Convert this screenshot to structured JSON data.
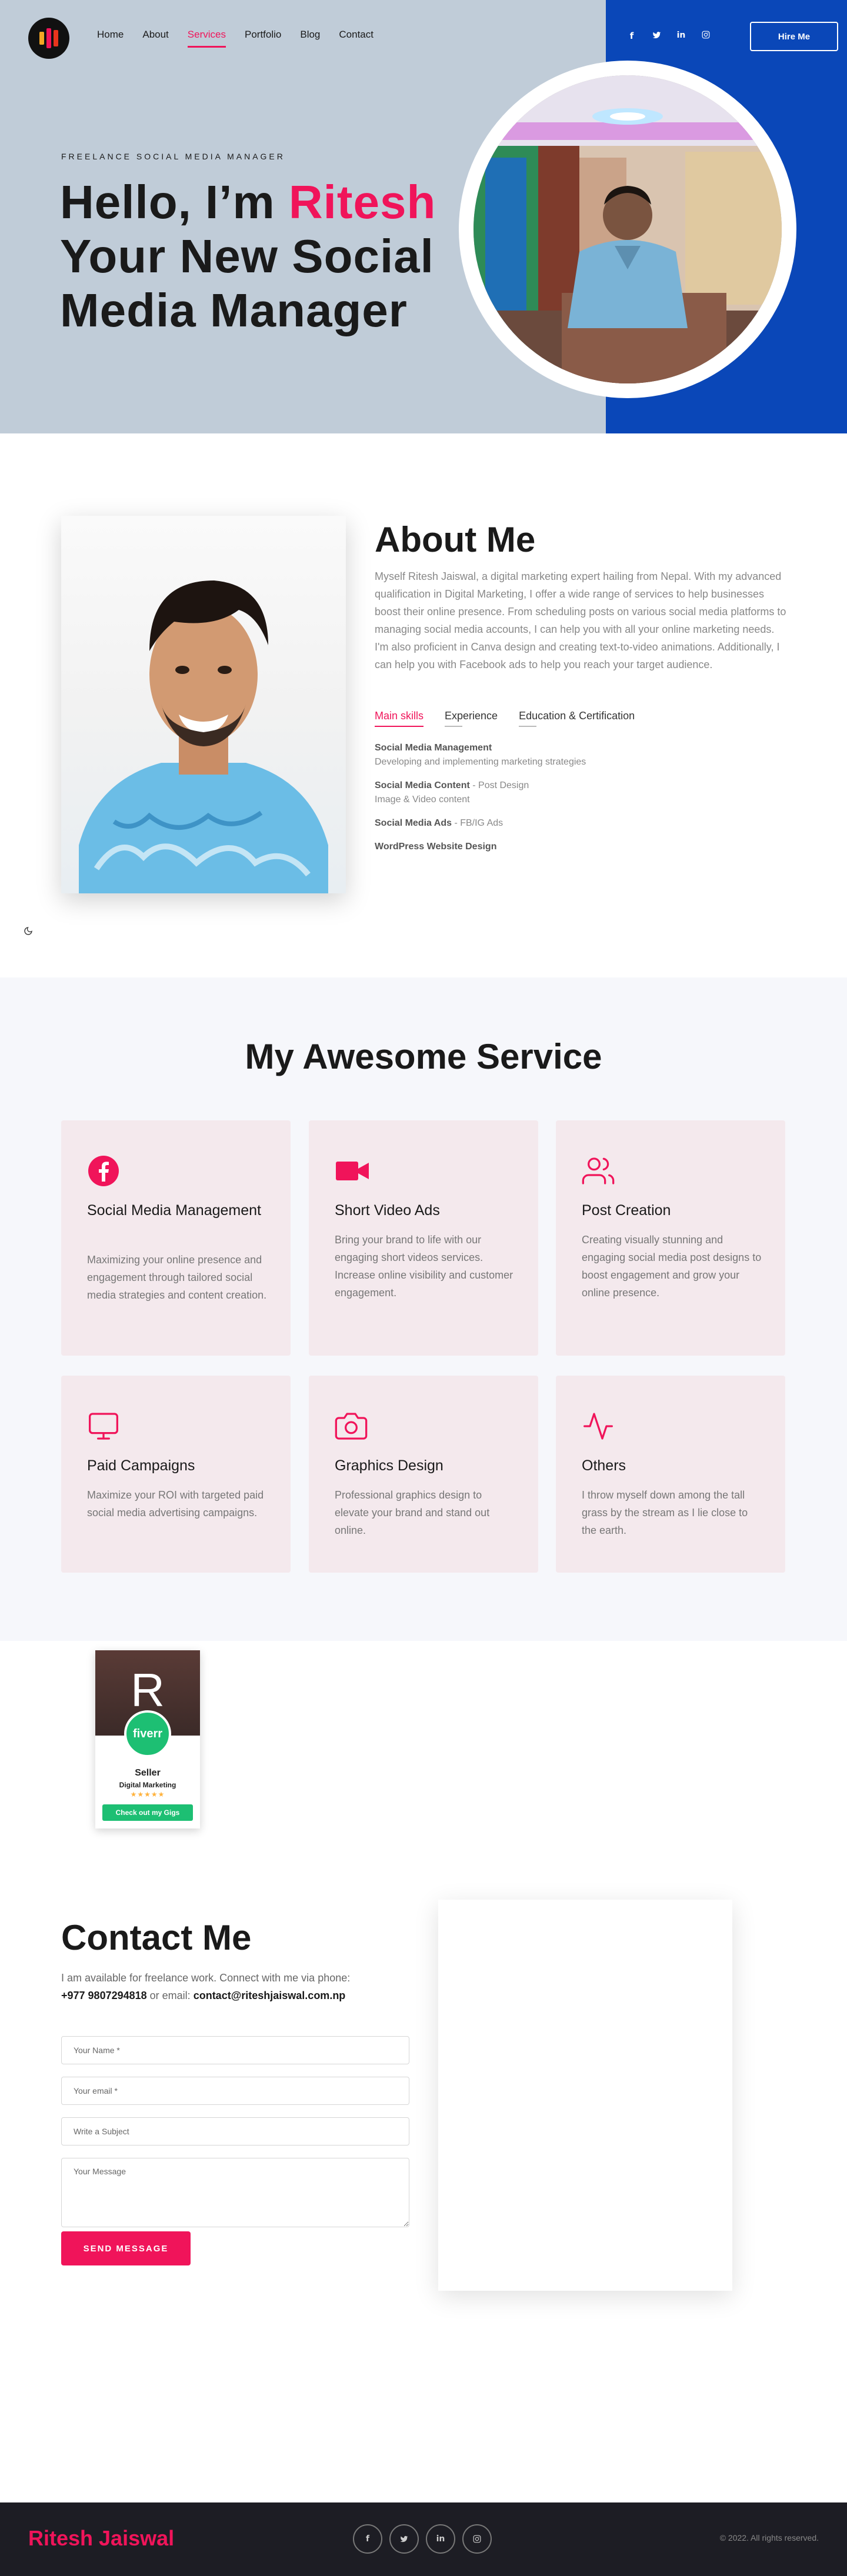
{
  "nav": {
    "links": [
      "Home",
      "About",
      "Services",
      "Portfolio",
      "Blog",
      "Contact"
    ],
    "active": "Services",
    "socials": [
      "facebook-icon",
      "twitter-icon",
      "linkedin-icon",
      "instagram-icon"
    ],
    "hire_label": "Hire Me"
  },
  "hero": {
    "eyebrow": "FREELANCE SOCIAL MEDIA MANAGER",
    "line1_prefix": "Hello, I’m ",
    "name": "Ritesh",
    "line2": "Your New Social",
    "line3": "Media Manager"
  },
  "about": {
    "title": "About Me",
    "text": "Myself Ritesh Jaiswal, a digital marketing expert hailing from Nepal. With my advanced qualification in Digital Marketing, I offer a wide range of services to help businesses boost their online presence. From scheduling posts on various social media platforms to managing social media accounts, I can help you with all your online marketing needs. I'm also proficient in Canva design and creating text-to-video animations. Additionally, I can help you with Facebook ads to help you reach your target audience.",
    "tabs": [
      "Main skills",
      "Experience",
      "Education & Certification"
    ],
    "skills": [
      {
        "title": "Social Media Management",
        "sub": "",
        "desc": "Developing and implementing marketing strategies"
      },
      {
        "title": "Social Media Content",
        "sub": " - Post Design",
        "desc": "Image & Video content"
      },
      {
        "title": "Social Media Ads",
        "sub": " - FB/IG Ads",
        "desc": ""
      },
      {
        "title": "WordPress Website Design",
        "sub": "",
        "desc": ""
      }
    ]
  },
  "services": {
    "title": "My Awesome Service",
    "items": [
      {
        "icon": "facebook-icon",
        "title": "Social Media Management",
        "desc": "Maximizing your online presence and engagement through tailored social media strategies and content creation."
      },
      {
        "icon": "video-camera-icon",
        "title": "Short Video Ads",
        "desc": "Bring your brand to life with our engaging short videos services. Increase online visibility and customer engagement."
      },
      {
        "icon": "users-icon",
        "title": "Post Creation",
        "desc": "Creating visually stunning and engaging social media post designs to boost engagement and grow your online presence."
      },
      {
        "icon": "monitor-icon",
        "title": "Paid Campaigns",
        "desc": "Maximize your ROI with targeted paid social media advertising campaigns."
      },
      {
        "icon": "camera-icon",
        "title": "Graphics Design",
        "desc": "Professional graphics design to elevate your brand and stand out online."
      },
      {
        "icon": "activity-icon",
        "title": "Others",
        "desc": "I throw myself down among the tall grass by the stream as I lie close to the earth."
      }
    ]
  },
  "fiverr": {
    "letter": "R",
    "badge": "fiverr",
    "level": "Seller",
    "category": "Digital Marketing",
    "stars": "★★★★★",
    "button": "Check out my Gigs"
  },
  "contact": {
    "title": "Contact Me",
    "intro": "I am available for freelance work. Connect with me via phone:",
    "phone": "+977 9807294818",
    "or_email": " or email: ",
    "email": "contact@riteshjaiswal.com.np",
    "name_ph": "Your Name *",
    "email_ph": "Your email *",
    "subject_ph": "Write a Subject",
    "message_ph": "Your Message",
    "send": "SEND MESSAGE"
  },
  "footer": {
    "brand": "Ritesh Jaiswal",
    "icons": [
      "facebook-icon",
      "twitter-icon",
      "linkedin-icon",
      "instagram-icon"
    ],
    "copyright": "© 2022. All rights reserved."
  },
  "colors": {
    "accent": "#f0145a",
    "hero_bg": "#c0ccd8",
    "hero_blue": "#0a47b8",
    "footer": "#1d1d24"
  }
}
